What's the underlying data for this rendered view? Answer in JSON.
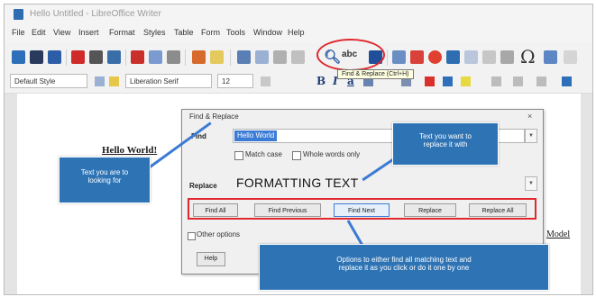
{
  "window": {
    "title": "Hello Untitled - LibreOffice Writer"
  },
  "menu": [
    "File",
    "Edit",
    "View",
    "Insert",
    "Format",
    "Styles",
    "Table",
    "Form",
    "Tools",
    "Window",
    "Help"
  ],
  "toolbar": {
    "find_abc": "abc",
    "tooltip": "Find & Replace (Ctrl+H)",
    "omega": "Ω",
    "paragraph_style": "Default Style",
    "font_name": "Liberation Serif",
    "font_size": "12",
    "bold": "B",
    "italic": "I",
    "underline": "a",
    "colors": {
      "accent_blue": "#2f6db3",
      "highlight_red": "#e0282e"
    }
  },
  "document": {
    "text_left": "Hello World!",
    "text_right": "Model"
  },
  "dialog": {
    "title": "Find & Replace",
    "close": "×",
    "find_label": "Find",
    "find_value": "Hello World",
    "match_case": "Match case",
    "whole_words": "Whole words only",
    "replace_label": "Replace",
    "replace_value": "FORMATTING TEXT",
    "buttons": [
      "Find All",
      "Find Previous",
      "Find Next",
      "Replace",
      "Replace All"
    ],
    "other_options": "Other options",
    "help": "Help"
  },
  "callouts": {
    "left": [
      "Text you are to",
      "looking for"
    ],
    "top": [
      "Text you want to",
      "replace it with"
    ],
    "bottom": [
      "Options to either find all matching text and",
      "replace it as you click or do it one by one"
    ]
  }
}
